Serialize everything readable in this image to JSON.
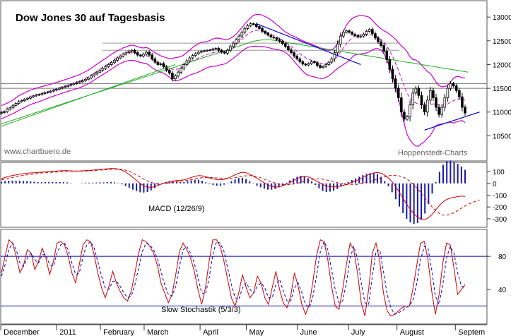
{
  "chart_data": [
    {
      "type": "candlestick",
      "title": "Dow Jones 30 auf Tagesbasis",
      "watermark_left": "www.chartbuero.de",
      "watermark_right": "Hoppenstedt-Charts",
      "y_ticks": [
        "13000",
        "12500",
        "12000",
        "11500",
        "11000",
        "10500"
      ],
      "y_values": [
        13000,
        12500,
        12000,
        11500,
        11000,
        10500
      ],
      "ylim": [
        10000,
        13300
      ],
      "x_labels": [
        "December",
        "2011",
        "February",
        "March",
        "April",
        "May",
        "June",
        "July",
        "August",
        "Septem"
      ],
      "close": [
        10990,
        11010,
        11060,
        11090,
        11140,
        11180,
        11220,
        11240,
        11270,
        11290,
        11320,
        11340,
        11360,
        11370,
        11390,
        11410,
        11420,
        11440,
        11460,
        11480,
        11500,
        11520,
        11540,
        11560,
        11580,
        11600,
        11620,
        11640,
        11660,
        11690,
        11720,
        11760,
        11800,
        11840,
        11880,
        11920,
        11960,
        12000,
        12040,
        12090,
        12140,
        12180,
        12220,
        12250,
        12280,
        12300,
        12250,
        12200,
        12180,
        12220,
        12260,
        12200,
        12120,
        12050,
        12000,
        12020,
        11950,
        11880,
        11820,
        11700,
        11760,
        11840,
        11920,
        12000,
        12080,
        12140,
        12190,
        12230,
        12260,
        12280,
        12290,
        12300,
        12310,
        12330,
        12340,
        12300,
        12260,
        12240,
        12300,
        12380,
        12450,
        12520,
        12600,
        12680,
        12760,
        12820,
        12860,
        12850,
        12800,
        12760,
        12700,
        12660,
        12620,
        12580,
        12560,
        12530,
        12490,
        12440,
        12380,
        12310,
        12250,
        12180,
        12120,
        12060,
        12010,
        11990,
        12020,
        12060,
        12040,
        11980,
        11940,
        11960,
        12000,
        12050,
        12120,
        12250,
        12430,
        12600,
        12680,
        12710,
        12680,
        12640,
        12610,
        12580,
        12600,
        12640,
        12700,
        12740,
        12650,
        12560,
        12480,
        12400,
        12280,
        12100,
        11900,
        11700,
        11500,
        11300,
        11000,
        10850,
        10900,
        11150,
        11400,
        11500,
        11350,
        11150,
        11000,
        11250,
        11450,
        11300,
        11100,
        10950,
        11100,
        11300,
        11500,
        11600,
        11550,
        11450,
        11320,
        11100,
        10980
      ],
      "ma": [
        {
          "name": "MA short",
          "color": "#cc00cc",
          "values": [
            11000,
            11020,
            11050,
            11080,
            11110,
            11150,
            11190,
            11220,
            11250,
            11280,
            11310,
            11330,
            11350,
            11370,
            11390,
            11410,
            11430,
            11450,
            11470,
            11490,
            11510,
            11530,
            11550,
            11570,
            11590,
            11610,
            11630,
            11650,
            11680,
            11710,
            11740,
            11780,
            11820,
            11860,
            11900,
            11940,
            11980,
            12020,
            12060,
            12100,
            12140,
            12170,
            12200,
            12220,
            12240,
            12250,
            12240,
            12220,
            12200,
            12190,
            12190,
            12160,
            12110,
            12070,
            12040,
            12010,
            11990,
            11960,
            11930,
            11900,
            11900,
            11910,
            11930,
            11960,
            12000,
            12040,
            12080,
            12110,
            12140,
            12170,
            12190,
            12210,
            12230,
            12250,
            12260,
            12270,
            12270,
            12270,
            12280,
            12320,
            12360,
            12410,
            12470,
            12530,
            12590,
            12640,
            12680,
            12710,
            12720,
            12720,
            12710,
            12690,
            12670,
            12640,
            12610,
            12580,
            12550,
            12510,
            12470,
            12430,
            12380,
            12330,
            12280,
            12230,
            12180,
            12140,
            12110,
            12090,
            12070,
            12050,
            12030,
            12020,
            12020,
            12030,
            12060,
            12110,
            12180,
            12260,
            12350,
            12430,
            12500,
            12560,
            12600,
            12620,
            12630,
            12630,
            12630,
            12630,
            12620,
            12600,
            12570,
            12530,
            12470,
            12390,
            12290,
            12170,
            12030,
            11880,
            11710,
            11550,
            11400,
            11290,
            11220,
            11190,
            11170,
            11160,
            11150,
            11150,
            11160,
            11170,
            11170,
            11150,
            11140,
            11150,
            11170,
            11210,
            11240,
            11270,
            11280,
            11270,
            11250
          ]
        },
        {
          "name": "MA long",
          "color": "#22aa22",
          "values": [
            10750,
            10770,
            10790,
            10810,
            10830,
            10850,
            10870,
            10890,
            10910,
            10930,
            10950,
            10970,
            10990,
            11010,
            11030,
            11050,
            11070,
            11090,
            11110,
            11130,
            11150,
            11170,
            11190,
            11210,
            11230,
            11250,
            11270,
            11290,
            11310,
            11330,
            11350,
            11370,
            11390,
            11410,
            11430,
            11450,
            11470,
            11490,
            11510,
            11530,
            11550,
            11570,
            11590,
            11610,
            11630,
            11650,
            11670,
            11690,
            11710,
            11730,
            11750,
            11770,
            11790,
            11810,
            11830,
            11850,
            11870,
            11890,
            11910,
            11930,
            11950,
            11970,
            11990,
            12010,
            12030,
            12050,
            12070,
            12090,
            12110,
            12130,
            12150,
            12170,
            12190,
            12210,
            12230,
            12250,
            12270,
            12290,
            12310,
            12330,
            12350,
            12370,
            12390,
            12410,
            12430,
            12450,
            12470,
            12490,
            12500,
            12510,
            12520,
            12520,
            12520,
            12520,
            12510,
            12500,
            12490,
            12480,
            12470,
            12460,
            12450,
            12440,
            12430,
            12420,
            12410,
            12400,
            12390,
            12380,
            12370,
            12360,
            12350,
            12340,
            12330,
            12320,
            12310,
            12300,
            12290,
            12280,
            12270,
            12260,
            12250,
            12240,
            12230,
            12220,
            12210,
            12200,
            12190,
            12180,
            12170,
            12160,
            12150,
            12140,
            12130,
            12120,
            12110,
            12100,
            12090,
            12080,
            12070,
            12060,
            12050,
            12040,
            12030,
            12020,
            12010,
            12000,
            11990,
            11980,
            11970,
            11960,
            11950,
            11940,
            11930,
            11920,
            11910,
            11900,
            11890,
            11880,
            11870,
            11860,
            11850,
            11840
          ]
        }
      ]
    },
    {
      "type": "line",
      "title": "MACD (12/26/9)",
      "y_ticks": [
        "100",
        "0",
        "-100",
        "-200",
        "-300"
      ],
      "y_values": [
        100,
        0,
        -100,
        -200,
        -300
      ],
      "ylim": [
        -360,
        160
      ],
      "series": [
        {
          "name": "MACD",
          "color": "#cc0000",
          "values": [
            40,
            50,
            60,
            66,
            72,
            78,
            82,
            86,
            88,
            90,
            92,
            95,
            98,
            100,
            102,
            104,
            106,
            108,
            108,
            106,
            104,
            104,
            106,
            108,
            110,
            112,
            115,
            118,
            120,
            124,
            126,
            126,
            122,
            112,
            96,
            76,
            50,
            26,
            0,
            -20,
            -32,
            -34,
            -28,
            -16,
            -4,
            6,
            14,
            20,
            24,
            26,
            30,
            38,
            50,
            60,
            66,
            64,
            56,
            46,
            38,
            32,
            30,
            34,
            44,
            58,
            72,
            86,
            94,
            90,
            78,
            62,
            44,
            24,
            4,
            -14,
            -26,
            -32,
            -30,
            -22,
            -8,
            8,
            24,
            40,
            54,
            60,
            56,
            44,
            26,
            8,
            -10,
            -22,
            -28,
            -30,
            -28,
            -22,
            -14,
            -4,
            8,
            20,
            34,
            50,
            66,
            78,
            88,
            92,
            86,
            70,
            46,
            14,
            -28,
            -76,
            -126,
            -176,
            -220,
            -258,
            -286,
            -304,
            -306,
            -290,
            -262,
            -224,
            -186,
            -156,
            -136,
            -124,
            -118,
            -112,
            -108,
            -110
          ]
        },
        {
          "name": "Signal",
          "color": "#cc0000",
          "dashed": true,
          "values": [
            30,
            36,
            44,
            50,
            56,
            62,
            68,
            72,
            76,
            80,
            84,
            88,
            90,
            92,
            94,
            96,
            98,
            100,
            102,
            104,
            104,
            104,
            104,
            104,
            106,
            108,
            110,
            112,
            114,
            116,
            118,
            120,
            120,
            118,
            112,
            102,
            88,
            72,
            54,
            36,
            20,
            8,
            0,
            -4,
            -4,
            -2,
            2,
            8,
            14,
            18,
            22,
            26,
            32,
            38,
            44,
            48,
            50,
            50,
            48,
            46,
            44,
            42,
            42,
            44,
            48,
            54,
            60,
            64,
            66,
            64,
            58,
            48,
            36,
            24,
            12,
            2,
            -6,
            -10,
            -12,
            -10,
            -6,
            0,
            8,
            16,
            24,
            32,
            36,
            38,
            36,
            30,
            22,
            14,
            6,
            -2,
            -8,
            -12,
            -12,
            -10,
            -6,
            0,
            8,
            16,
            26,
            36,
            46,
            56,
            64,
            68,
            68,
            64,
            54,
            38,
            16,
            -12,
            -46,
            -84,
            -124,
            -164,
            -200,
            -232,
            -256,
            -268,
            -270,
            -262,
            -248,
            -230,
            -210,
            -192,
            -176,
            -162,
            -150,
            -140
          ]
        }
      ]
    },
    {
      "type": "line",
      "title": "Slow Stochastik (5/3/3)",
      "y_ticks": [
        "80",
        "40"
      ],
      "y_values": [
        80,
        40
      ],
      "ylim": [
        0,
        110
      ],
      "series": [
        {
          "name": "%K",
          "color": "#cc0000",
          "values": [
            60,
            80,
            100,
            96,
            80,
            60,
            70,
            88,
            84,
            64,
            74,
            90,
            78,
            58,
            74,
            96,
            98,
            94,
            80,
            60,
            48,
            70,
            94,
            100,
            98,
            82,
            60,
            42,
            30,
            44,
            62,
            48,
            38,
            30,
            26,
            38,
            60,
            84,
            100,
            98,
            92,
            84,
            70,
            48,
            36,
            24,
            34,
            58,
            86,
            96,
            88,
            78,
            62,
            40,
            22,
            42,
            74,
            100,
            100,
            92,
            74,
            52,
            30,
            20,
            36,
            58,
            42,
            30,
            36,
            56,
            48,
            30,
            22,
            42,
            62,
            40,
            24,
            18,
            32,
            60,
            44,
            22,
            10,
            22,
            50,
            82,
            100,
            98,
            76,
            44,
            20,
            16,
            40,
            70,
            96,
            88,
            60,
            24,
            8,
            40,
            84,
            96,
            74,
            36,
            14,
            8,
            10,
            14,
            18,
            20,
            20,
            42,
            70,
            96,
            98,
            76,
            38,
            10,
            34,
            72,
            96,
            94,
            66,
            34,
            40,
            46
          ]
        },
        {
          "name": "%D",
          "color": "#0000cc",
          "dashed": true,
          "values": [
            56,
            70,
            88,
            96,
            88,
            72,
            68,
            78,
            84,
            76,
            72,
            82,
            82,
            70,
            68,
            84,
            94,
            96,
            88,
            72,
            58,
            60,
            80,
            94,
            98,
            90,
            74,
            56,
            42,
            40,
            50,
            50,
            44,
            36,
            30,
            32,
            46,
            66,
            86,
            96,
            94,
            88,
            78,
            62,
            46,
            34,
            32,
            44,
            68,
            88,
            92,
            84,
            72,
            54,
            36,
            34,
            54,
            82,
            98,
            96,
            86,
            66,
            46,
            30,
            28,
            42,
            48,
            40,
            36,
            44,
            48,
            42,
            30,
            30,
            46,
            52,
            38,
            26,
            26,
            42,
            48,
            36,
            22,
            18,
            32,
            58,
            86,
            98,
            88,
            64,
            40,
            24,
            26,
            48,
            78,
            92,
            78,
            48,
            24,
            22,
            56,
            86,
            88,
            62,
            34,
            18,
            10,
            12,
            14,
            18,
            20,
            28,
            48,
            76,
            92,
            90,
            64,
            32,
            22,
            46,
            78,
            92,
            84,
            60,
            44,
            42
          ]
        }
      ]
    }
  ]
}
